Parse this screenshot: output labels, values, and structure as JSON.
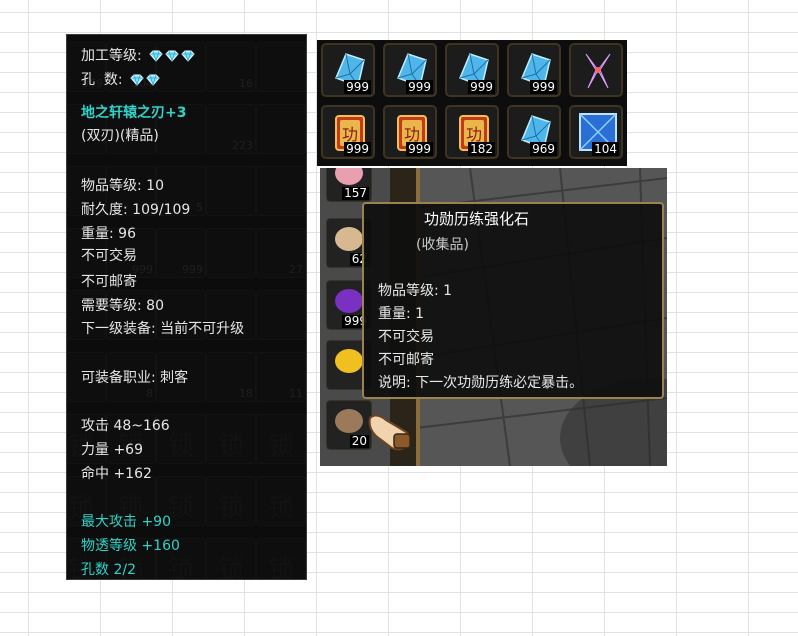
{
  "item_tooltip": {
    "refine_label": "加工等级:",
    "sockets_label": "孔  数:",
    "name": "地之轩辕之刃+3",
    "type": "(双刃)(精品)",
    "item_level": "物品等级: 10",
    "durability": "耐久度: 109/109",
    "weight": "重量: 96",
    "untradeable": "不可交易",
    "unmailable": "不可邮寄",
    "required_level": "需要等级: 80",
    "next_upgrade": "下一级装备: 当前不可升级",
    "job": "可装备职业: 刺客",
    "attack": "攻击 48~166",
    "strength": "力量 +69",
    "hit": "命中 +162",
    "max_attack": "最大攻击 +90",
    "penetration": "物透等级 +160",
    "sockets": "孔数 2/2",
    "refine_gems": 3,
    "socket_gems": 2
  },
  "background_inventory": {
    "counts": [
      "969",
      "104",
      "16",
      "223",
      "5",
      "999",
      "999",
      "27",
      "8",
      "18",
      "11"
    ],
    "lock_glyph": "锁"
  },
  "inventory_strip": {
    "row1": [
      {
        "icon": "blue-crystal-icon",
        "count": "999"
      },
      {
        "icon": "blue-crystal-icon",
        "count": "999"
      },
      {
        "icon": "blue-crystal-icon",
        "count": "999"
      },
      {
        "icon": "blue-crystal-icon",
        "count": "999"
      },
      {
        "icon": "purple-weapon-icon",
        "count": ""
      }
    ],
    "row2": [
      {
        "icon": "merit-scroll-icon",
        "count": "999"
      },
      {
        "icon": "merit-scroll-icon",
        "count": "999"
      },
      {
        "icon": "merit-scroll-icon",
        "count": "182"
      },
      {
        "icon": "blue-crystal-icon",
        "count": "969"
      },
      {
        "icon": "blue-gem-square-icon",
        "count": "104"
      }
    ]
  },
  "scene": {
    "side_counts": [
      "157",
      "62",
      "999",
      "",
      "20"
    ],
    "tooltip": {
      "title": "功勋历练强化石",
      "category": "(收集品)",
      "item_level": "物品等级: 1",
      "weight": "重量: 1",
      "untradeable": "不可交易",
      "unmailable": "不可邮寄",
      "description": "说明: 下一次功勋历练必定暴击。"
    }
  },
  "colors": {
    "cyan_text": "#2fd3c8",
    "tooltip_border": "#9a8350",
    "slot_border": "#3e3420"
  }
}
